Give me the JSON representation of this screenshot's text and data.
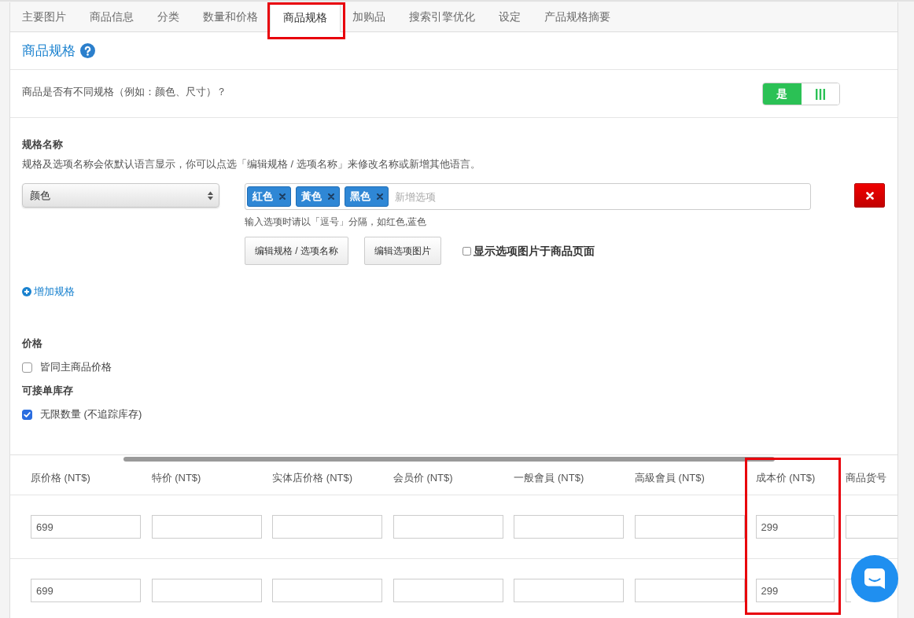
{
  "tabs": [
    {
      "label": "主要图片",
      "selected": false,
      "highlighted": false
    },
    {
      "label": "商品信息",
      "selected": false,
      "highlighted": false
    },
    {
      "label": "分类",
      "selected": false,
      "highlighted": false
    },
    {
      "label": "数量和价格",
      "selected": false,
      "highlighted": false
    },
    {
      "label": "商品规格",
      "selected": true,
      "highlighted": true
    },
    {
      "label": "加购品",
      "selected": false,
      "highlighted": false
    },
    {
      "label": "搜索引擎优化",
      "selected": false,
      "highlighted": false
    },
    {
      "label": "设定",
      "selected": false,
      "highlighted": false
    },
    {
      "label": "产品规格摘要",
      "selected": false,
      "highlighted": false
    }
  ],
  "section": {
    "title": "商品规格"
  },
  "variants_question": {
    "label": "商品是否有不同规格（例如：颜色、尺寸）？",
    "toggle": {
      "label": "是",
      "on": true
    }
  },
  "spec_names": {
    "title": "规格名称",
    "description": "规格及选项名称会依默认语言显示，你可以点选「编辑规格 / 选项名称」来修改名称或新增其他语言。",
    "specs": [
      {
        "name": "颜色",
        "options": [
          {
            "label": "紅色"
          },
          {
            "label": "黃色"
          },
          {
            "label": "黑色"
          }
        ],
        "placeholder": "新增选项",
        "hint": "输入选项时请以「逗号」分隔，如红色,蓝色",
        "buttons": [
          "编辑规格 / 选项名称",
          "编辑选项图片"
        ],
        "show_images": {
          "label": "显示选项图片于商品页面",
          "checked": false
        }
      }
    ],
    "add_link": "增加规格"
  },
  "price": {
    "title": "价格",
    "same_as_main": {
      "label": "皆同主商品价格",
      "checked": false
    }
  },
  "stock": {
    "title": "可接单库存",
    "unlimited": {
      "label": "无限数量 (不追踪库存)",
      "checked": true
    }
  },
  "table": {
    "columns": [
      {
        "label": "原价格 (NT$)",
        "highlighted": false,
        "values": [
          "699",
          "699"
        ]
      },
      {
        "label": "特价 (NT$)",
        "highlighted": false
      },
      {
        "label": "实体店价格 (NT$)",
        "highlighted": false
      },
      {
        "label": "会员价 (NT$)",
        "highlighted": false
      },
      {
        "label": "一般會員 (NT$)",
        "highlighted": false
      },
      {
        "label": "高級會員 (NT$)",
        "highlighted": false
      },
      {
        "label": "成本价 (NT$)",
        "highlighted": true,
        "values": [
          "299",
          "299"
        ]
      },
      {
        "label": "商品货号",
        "highlighted": false
      }
    ]
  }
}
